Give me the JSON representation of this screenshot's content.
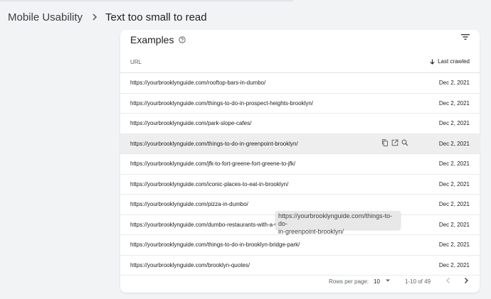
{
  "breadcrumb": {
    "root": "Mobile Usability",
    "current": "Text too small to read"
  },
  "card": {
    "title": "Examples",
    "columns": {
      "url": "URL",
      "last_crawled": "Last crawled"
    }
  },
  "rows": [
    {
      "url": "https://yourbrooklynguide.com/rooftop-bars-in-dumbo/",
      "date": "Dec 2, 2021"
    },
    {
      "url": "https://yourbrooklynguide.com/things-to-do-in-prospect-heights-brooklyn/",
      "date": "Dec 2, 2021"
    },
    {
      "url": "https://yourbrooklynguide.com/park-slope-cafes/",
      "date": "Dec 2, 2021"
    },
    {
      "url": "https://yourbrooklynguide.com/things-to-do-in-greenpoint-brooklyn/",
      "date": "Dec 2, 2021"
    },
    {
      "url": "https://yourbrooklynguide.com/jfk-to-fort-greene-fort-greene-to-jfk/",
      "date": "Dec 2, 2021"
    },
    {
      "url": "https://yourbrooklynguide.com/iconic-places-to-eat-in-brooklyn/",
      "date": "Dec 2, 2021"
    },
    {
      "url": "https://yourbrooklynguide.com/pizza-in-dumbo/",
      "date": "Dec 2, 2021"
    },
    {
      "url": "https://yourbrooklynguide.com/dumbo-restaurants-with-a-view",
      "date": "Dec 2, 2021"
    },
    {
      "url": "https://yourbrooklynguide.com/things-to-do-in-brooklyn-bridge-park/",
      "date": "Dec 2, 2021"
    },
    {
      "url": "https://yourbrooklynguide.com/brooklyn-quotes/",
      "date": "Dec 2, 2021"
    }
  ],
  "hovered_row_actions": [
    "copy-icon",
    "open-in-new-icon",
    "inspect-url-icon"
  ],
  "tooltip": {
    "line1": "https://yourbrooklynguide.com/things-to-do-",
    "line2": "in-greenpoint-brooklyn/"
  },
  "pagination": {
    "rows_per_page_label": "Rows per page:",
    "rows_per_page_value": "10",
    "range": "1-10 of 49"
  },
  "colors": {
    "page_bg": "#f1f3f4",
    "card_bg": "#ffffff",
    "hover_row": "#eeeeee",
    "tooltip_bg": "#e8e8e8"
  }
}
